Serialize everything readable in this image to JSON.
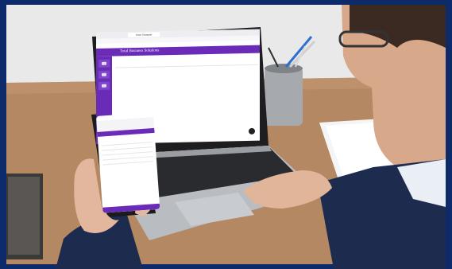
{
  "scene": {
    "background": "#0d2a6b",
    "desk_color": "#a87a55",
    "wall_color": "#e6e6e6",
    "accent": "#6a2cb8"
  },
  "laptop_ui": {
    "browser_tab": "Point Transport",
    "app_title": "Total Business Solutions",
    "nav_items": [
      "",
      "",
      "",
      "",
      ""
    ]
  },
  "phone_ui": {
    "status_time": "",
    "header": "",
    "section_title": ""
  }
}
